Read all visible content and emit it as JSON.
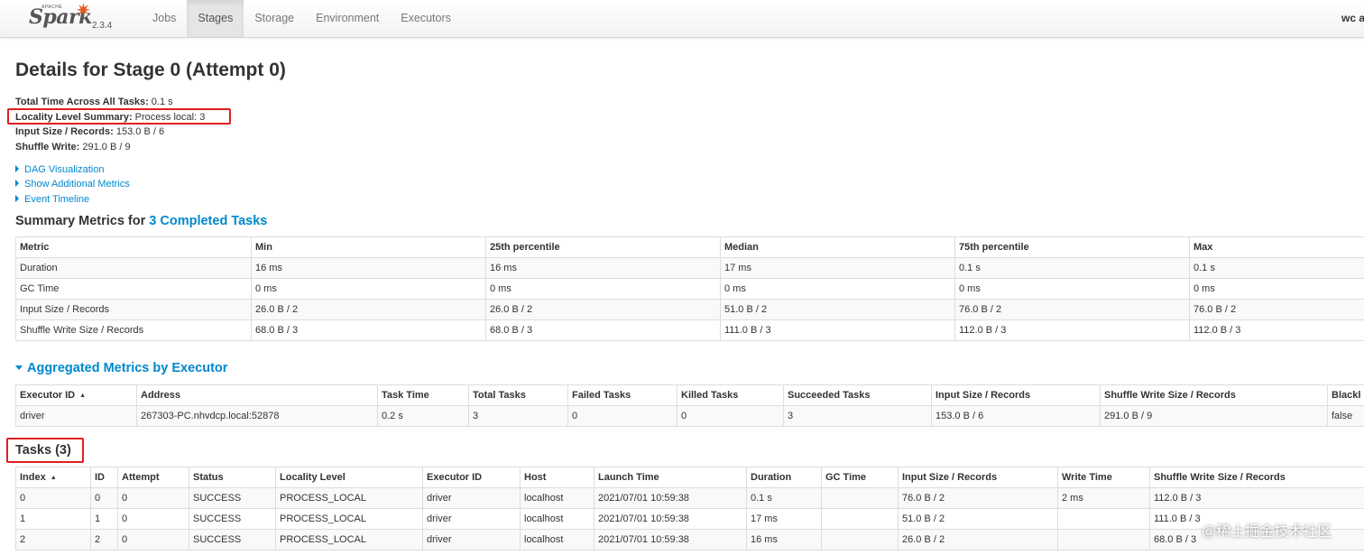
{
  "nav": {
    "brand_apache": "APACHE",
    "brand_name": "Spark",
    "version": "2.3.4",
    "tabs": [
      {
        "label": "Jobs",
        "active": false
      },
      {
        "label": "Stages",
        "active": true
      },
      {
        "label": "Storage",
        "active": false
      },
      {
        "label": "Environment",
        "active": false
      },
      {
        "label": "Executors",
        "active": false
      }
    ],
    "user": "wc a"
  },
  "page": {
    "title": "Details for Stage 0 (Attempt 0)"
  },
  "summary": [
    {
      "label": "Total Time Across All Tasks:",
      "value": "0.1 s"
    },
    {
      "label": "Locality Level Summary:",
      "value": "Process local: 3"
    },
    {
      "label": "Input Size / Records:",
      "value": "153.0 B / 6"
    },
    {
      "label": "Shuffle Write:",
      "value": "291.0 B / 9"
    }
  ],
  "expanders": [
    "DAG Visualization",
    "Show Additional Metrics",
    "Event Timeline"
  ],
  "summary_metrics": {
    "title_prefix": "Summary Metrics for",
    "title_link": "3 Completed Tasks",
    "headers": [
      "Metric",
      "Min",
      "25th percentile",
      "Median",
      "75th percentile",
      "Max"
    ],
    "rows": [
      [
        "Duration",
        "16 ms",
        "16 ms",
        "17 ms",
        "0.1 s",
        "0.1 s"
      ],
      [
        "GC Time",
        "0 ms",
        "0 ms",
        "0 ms",
        "0 ms",
        "0 ms"
      ],
      [
        "Input Size / Records",
        "26.0 B / 2",
        "26.0 B / 2",
        "51.0 B / 2",
        "76.0 B / 2",
        "76.0 B / 2"
      ],
      [
        "Shuffle Write Size / Records",
        "68.0 B / 3",
        "68.0 B / 3",
        "111.0 B / 3",
        "112.0 B / 3",
        "112.0 B / 3"
      ]
    ]
  },
  "aggregated": {
    "title": "Aggregated Metrics by Executor",
    "headers": [
      "Executor ID",
      "Address",
      "Task Time",
      "Total Tasks",
      "Failed Tasks",
      "Killed Tasks",
      "Succeeded Tasks",
      "Input Size / Records",
      "Shuffle Write Size / Records",
      "Blackl"
    ],
    "sort_arrow": "▲",
    "rows": [
      [
        "driver",
        "267303-PC.nhvdcp.local:52878",
        "0.2 s",
        "3",
        "0",
        "0",
        "3",
        "153.0 B / 6",
        "291.0 B / 9",
        "false"
      ]
    ]
  },
  "tasks": {
    "title": "Tasks (3)",
    "headers": [
      "Index",
      "ID",
      "Attempt",
      "Status",
      "Locality Level",
      "Executor ID",
      "Host",
      "Launch Time",
      "Duration",
      "GC Time",
      "Input Size / Records",
      "Write Time",
      "Shuffle Write Size / Records"
    ],
    "sort_arrow": "▲",
    "rows": [
      [
        "0",
        "0",
        "0",
        "SUCCESS",
        "PROCESS_LOCAL",
        "driver",
        "localhost",
        "2021/07/01 10:59:38",
        "0.1 s",
        "",
        "76.0 B / 2",
        "2 ms",
        "112.0 B / 3"
      ],
      [
        "1",
        "1",
        "0",
        "SUCCESS",
        "PROCESS_LOCAL",
        "driver",
        "localhost",
        "2021/07/01 10:59:38",
        "17 ms",
        "",
        "51.0 B / 2",
        "",
        "111.0 B / 3"
      ],
      [
        "2",
        "2",
        "0",
        "SUCCESS",
        "PROCESS_LOCAL",
        "driver",
        "localhost",
        "2021/07/01 10:59:38",
        "16 ms",
        "",
        "26.0 B / 2",
        "",
        "68.0 B / 3"
      ]
    ]
  },
  "watermark": "@稀土掘金技术社区",
  "colors": {
    "link": "#0088cc",
    "highlight": "#e02020",
    "spark_orange": "#e25a1c"
  }
}
